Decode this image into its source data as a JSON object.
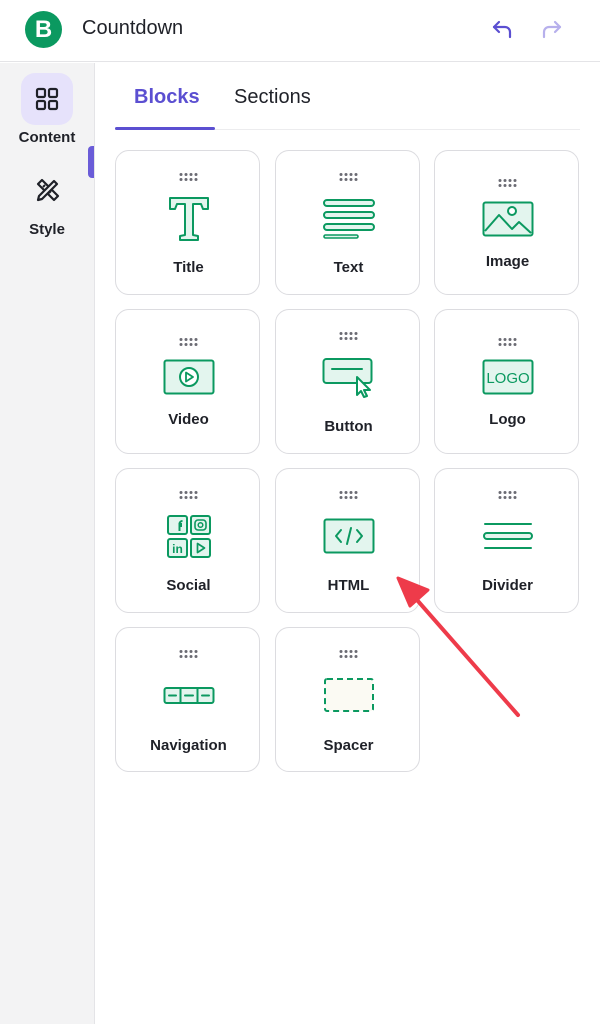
{
  "header": {
    "logo_letter": "B",
    "title": "Countdown",
    "undo_icon": "undo-icon",
    "redo_icon": "redo-icon"
  },
  "rail": {
    "items": [
      {
        "label": "Content",
        "icon": "grid-icon",
        "active": true
      },
      {
        "label": "Style",
        "icon": "brush-ruler-icon",
        "active": false
      }
    ]
  },
  "tabs": [
    {
      "label": "Blocks",
      "active": true
    },
    {
      "label": "Sections",
      "active": false
    }
  ],
  "blocks": [
    {
      "label": "Title",
      "icon": "title-t-icon"
    },
    {
      "label": "Text",
      "icon": "text-lines-icon"
    },
    {
      "label": "Image",
      "icon": "image-icon"
    },
    {
      "label": "Video",
      "icon": "video-play-icon"
    },
    {
      "label": "Button",
      "icon": "button-cursor-icon"
    },
    {
      "label": "Logo",
      "icon": "logo-icon",
      "icon_text": "LOGO"
    },
    {
      "label": "Social",
      "icon": "social-icon"
    },
    {
      "label": "HTML",
      "icon": "code-icon"
    },
    {
      "label": "Divider",
      "icon": "divider-icon"
    },
    {
      "label": "Navigation",
      "icon": "navigation-icon"
    },
    {
      "label": "Spacer",
      "icon": "spacer-icon"
    }
  ],
  "colors": {
    "accent": "#5b4fd1",
    "icon_green": "#0b9960",
    "icon_fill": "#e3f5ee",
    "arrow": "#ee3b4a"
  }
}
